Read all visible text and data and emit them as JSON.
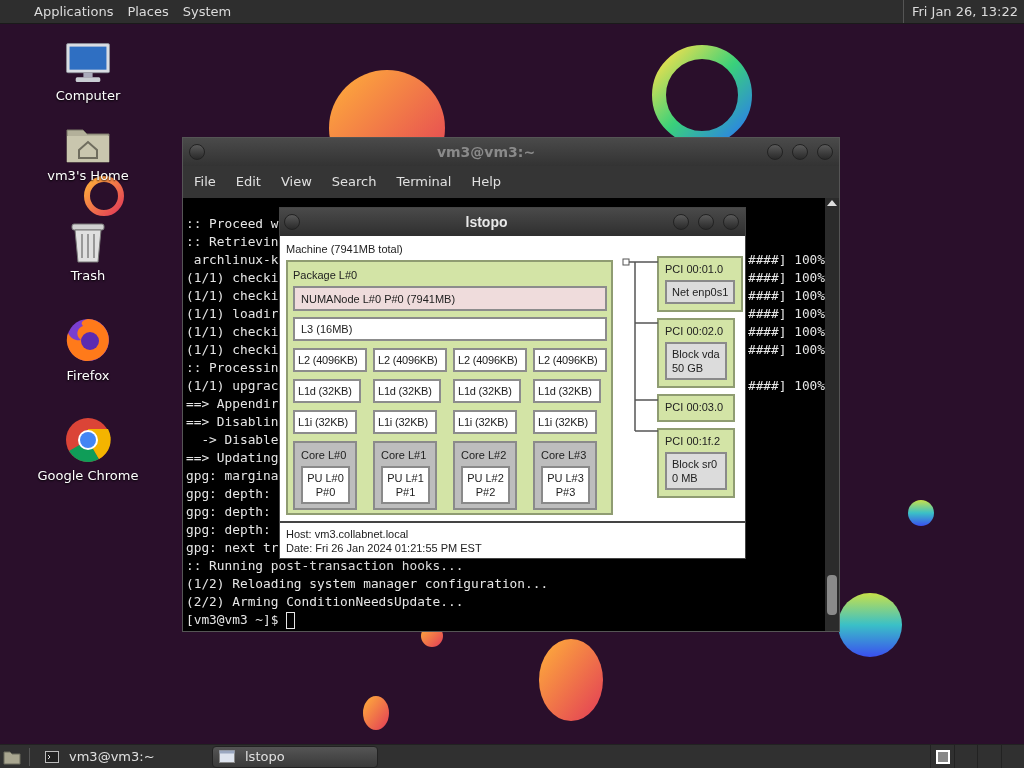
{
  "top_panel": {
    "menus": [
      "Applications",
      "Places",
      "System"
    ],
    "clock": "Fri Jan 26, 13:22"
  },
  "desktop_icons": [
    {
      "label": "Computer",
      "kind": "computer"
    },
    {
      "label": "vm3's Home",
      "kind": "home"
    },
    {
      "label": "Trash",
      "kind": "trash"
    },
    {
      "label": "Firefox",
      "kind": "firefox"
    },
    {
      "label": "Google Chrome",
      "kind": "chrome"
    }
  ],
  "terminal_window": {
    "title": "vm3@vm3:~",
    "menu": [
      "File",
      "Edit",
      "View",
      "Search",
      "Terminal",
      "Help"
    ],
    "lines": [
      {
        "left": ":: Proceed w"
      },
      {
        "left": ":: Retrievin"
      },
      {
        "left": " archlinux-k",
        "right": "####] 100%"
      },
      {
        "left": "(1/1) checki",
        "right": "####] 100%"
      },
      {
        "left": "(1/1) checki",
        "right": "####] 100%"
      },
      {
        "left": "(1/1) loadir",
        "right": "####] 100%"
      },
      {
        "left": "(1/1) checki",
        "right": "####] 100%"
      },
      {
        "left": "(1/1) checki",
        "right": "####] 100%"
      },
      {
        "left": ":: Processin"
      },
      {
        "left": "(1/1) upgrac",
        "right": "####] 100%"
      },
      {
        "left": "==> Appendir"
      },
      {
        "left": "==> Disablin"
      },
      {
        "left": "  -> Disable"
      },
      {
        "left": "==> Updating"
      },
      {
        "left": "gpg: margina"
      },
      {
        "left": "gpg: depth: "
      },
      {
        "left": "gpg: depth: "
      },
      {
        "left": "gpg: depth: "
      },
      {
        "left": "gpg: next tr"
      },
      {
        "left": ":: Running post-transaction hooks..."
      },
      {
        "left": "(1/2) Reloading system manager configuration..."
      },
      {
        "left": "(2/2) Arming ConditionNeedsUpdate..."
      }
    ],
    "prompt": "[vm3@vm3 ~]$ "
  },
  "lstopo_window": {
    "title": "lstopo",
    "machine": "Machine (7941MB total)",
    "package": {
      "label": "Package L#0",
      "numa": "NUMANode L#0 P#0 (7941MB)",
      "l3": "L3 (16MB)",
      "cores": [
        {
          "l2": "L2 (4096KB)",
          "l1d": "L1d (32KB)",
          "l1i": "L1i (32KB)",
          "core": "Core L#0",
          "pu": "PU L#0\nP#0"
        },
        {
          "l2": "L2 (4096KB)",
          "l1d": "L1d (32KB)",
          "l1i": "L1i (32KB)",
          "core": "Core L#1",
          "pu": "PU L#1\nP#1"
        },
        {
          "l2": "L2 (4096KB)",
          "l1d": "L1d (32KB)",
          "l1i": "L1i (32KB)",
          "core": "Core L#2",
          "pu": "PU L#2\nP#2"
        },
        {
          "l2": "L2 (4096KB)",
          "l1d": "L1d (32KB)",
          "l1i": "L1i (32KB)",
          "core": "Core L#3",
          "pu": "PU L#3\nP#3"
        }
      ]
    },
    "pci": [
      {
        "label": "PCI 00:01.0",
        "device": "Net enp0s1"
      },
      {
        "label": "PCI 00:02.0",
        "device": "Block vda\n50 GB"
      },
      {
        "label": "PCI 00:03.0"
      },
      {
        "label": "PCI 00:1f.2",
        "device": "Block sr0\n0 MB"
      }
    ],
    "host": "Host: vm3.collabnet.local",
    "date": "Date: Fri 26 Jan 2024 01:21:55 PM EST"
  },
  "taskbar": {
    "tasks": [
      {
        "label": "vm3@vm3:~",
        "kind": "terminal",
        "selected": false
      },
      {
        "label": "lstopo",
        "kind": "window",
        "selected": true
      }
    ]
  }
}
